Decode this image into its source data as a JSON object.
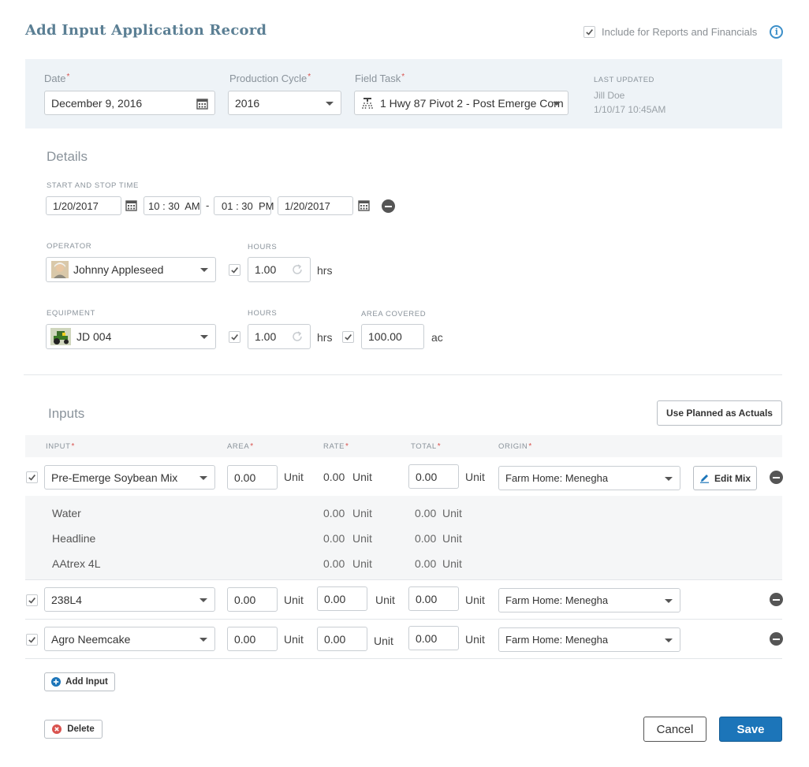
{
  "page": {
    "title": "Add Input Application Record",
    "include_reports_label": "Include for Reports and Financials"
  },
  "header": {
    "date_label": "Date",
    "date_value": "December 9, 2016",
    "cycle_label": "Production Cycle",
    "cycle_value": "2016",
    "task_label": "Field Task",
    "task_value": "1 Hwy 87 Pivot 2 - Post Emerge Corn",
    "last_updated_label": "LAST UPDATED",
    "last_updated_by": "Jill Doe",
    "last_updated_at": "1/10/17 10:45AM"
  },
  "details": {
    "title": "Details",
    "time_label": "START AND STOP TIME",
    "start_date": "1/20/2017",
    "start_time": "10 : 30  AM",
    "dash": "-",
    "stop_time": "01 : 30  PM",
    "stop_date": "1/20/2017",
    "operator_label": "OPERATOR",
    "operator_value": "Johnny Appleseed",
    "hours_label": "HOURS",
    "operator_hours": "1.00",
    "hrs": "hrs",
    "equipment_label": "EQUIPMENT",
    "equipment_value": "JD 004",
    "equipment_hours": "1.00",
    "area_label": "AREA COVERED",
    "area_value": "100.00",
    "area_unit": "ac"
  },
  "inputs": {
    "title": "Inputs",
    "use_planned_label": "Use Planned as Actuals",
    "col_input": "INPUT",
    "col_area": "AREA",
    "col_rate": "RATE",
    "col_total": "TOTAL",
    "col_origin": "ORIGIN",
    "unit": "Unit",
    "edit_mix_label": "Edit Mix",
    "rows": [
      {
        "name": "Pre-Emerge Soybean Mix",
        "area": "0.00",
        "rate": "0.00",
        "total": "0.00",
        "origin": "Farm Home: Menegha"
      },
      {
        "name": "238L4",
        "area": "0.00",
        "rate": "0.00",
        "total": "0.00",
        "origin": "Farm Home: Menegha"
      },
      {
        "name": "Agro Neemcake",
        "area": "0.00",
        "rate": "0.00",
        "total": "0.00",
        "origin": "Farm Home: Menegha"
      }
    ],
    "mix_items": [
      {
        "name": "Water",
        "rate": "0.00",
        "total": "0.00"
      },
      {
        "name": "Headline",
        "rate": "0.00",
        "total": "0.00"
      },
      {
        "name": "AAtrex 4L",
        "rate": "0.00",
        "total": "0.00"
      }
    ],
    "add_input_label": "Add Input"
  },
  "footer": {
    "delete_label": "Delete",
    "cancel_label": "Cancel",
    "save_label": "Save"
  },
  "colors": {
    "title": "#5b7f94",
    "header_band": "#eef3f7",
    "primary": "#1c75b9",
    "required": "#d9534f"
  }
}
